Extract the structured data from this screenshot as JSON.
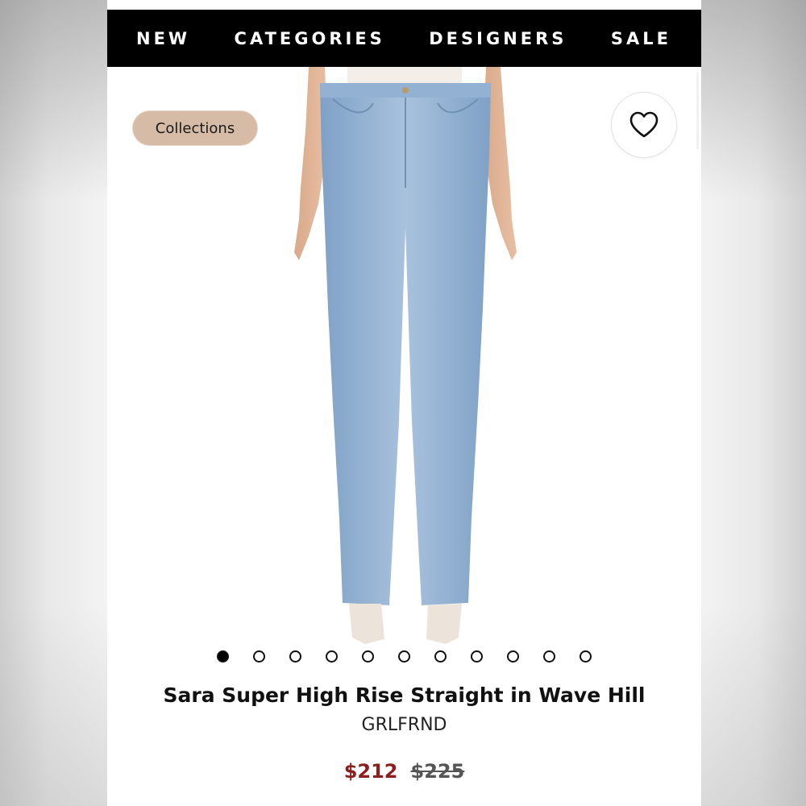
{
  "nav": {
    "items": [
      {
        "label": "NEW"
      },
      {
        "label": "CATEGORIES"
      },
      {
        "label": "DESIGNERS"
      },
      {
        "label": "SALE"
      }
    ]
  },
  "collections_chip": {
    "label": "Collections"
  },
  "favorite": {
    "icon": "heart-icon"
  },
  "carousel": {
    "total": 11,
    "active_index": 0
  },
  "product": {
    "name": "Sara Super High Rise Straight in Wave Hill",
    "brand": "GRLFRND",
    "sale_price": "$212",
    "original_price": "$225"
  },
  "colors": {
    "navbar": "#000000",
    "chip": "#d6bba6",
    "sale_price": "#8b1e1e",
    "denim": "#8fb0d2"
  }
}
